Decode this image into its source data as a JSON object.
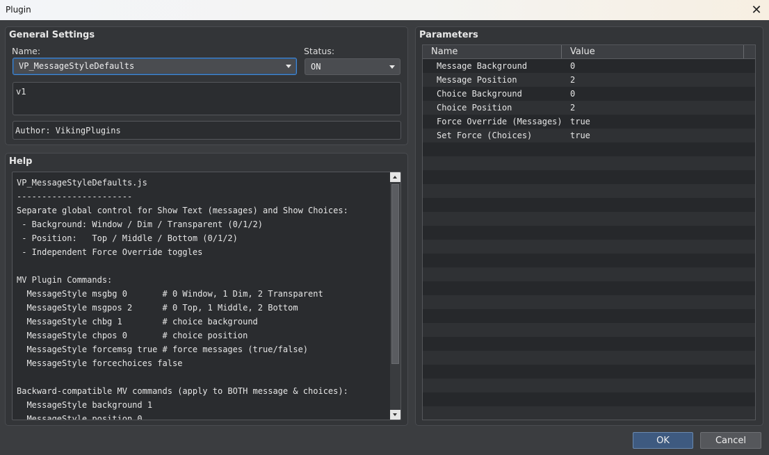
{
  "window": {
    "title": "Plugin",
    "close_icon": "close-icon"
  },
  "general": {
    "heading": "General Settings",
    "name_label": "Name:",
    "name_value": "VP_MessageStyleDefaults",
    "status_label": "Status:",
    "status_value": "ON",
    "description": "v1",
    "author": "Author: VikingPlugins"
  },
  "help": {
    "heading": "Help",
    "text": "VP_MessageStyleDefaults.js\n-----------------------\nSeparate global control for Show Text (messages) and Show Choices:\n - Background: Window / Dim / Transparent (0/1/2)\n - Position:   Top / Middle / Bottom (0/1/2)\n - Independent Force Override toggles\n\nMV Plugin Commands:\n  MessageStyle msgbg 0       # 0 Window, 1 Dim, 2 Transparent\n  MessageStyle msgpos 2      # 0 Top, 1 Middle, 2 Bottom\n  MessageStyle chbg 1        # choice background\n  MessageStyle chpos 0       # choice position\n  MessageStyle forcemsg true # force messages (true/false)\n  MessageStyle forcechoices false\n\nBackward-compatible MV commands (apply to BOTH message & choices):\n  MessageStyle background 1\n  MessageStyle position 0"
  },
  "parameters": {
    "heading": "Parameters",
    "columns": [
      "Name",
      "Value"
    ],
    "rows": [
      {
        "name": "Message Background",
        "value": "0"
      },
      {
        "name": "Message Position",
        "value": "2"
      },
      {
        "name": "Choice Background",
        "value": "0"
      },
      {
        "name": "Choice Position",
        "value": "2"
      },
      {
        "name": "Force Override (Messages)",
        "value": "true"
      },
      {
        "name": "Set Force (Choices)",
        "value": "true"
      }
    ]
  },
  "buttons": {
    "ok": "OK",
    "cancel": "Cancel"
  }
}
